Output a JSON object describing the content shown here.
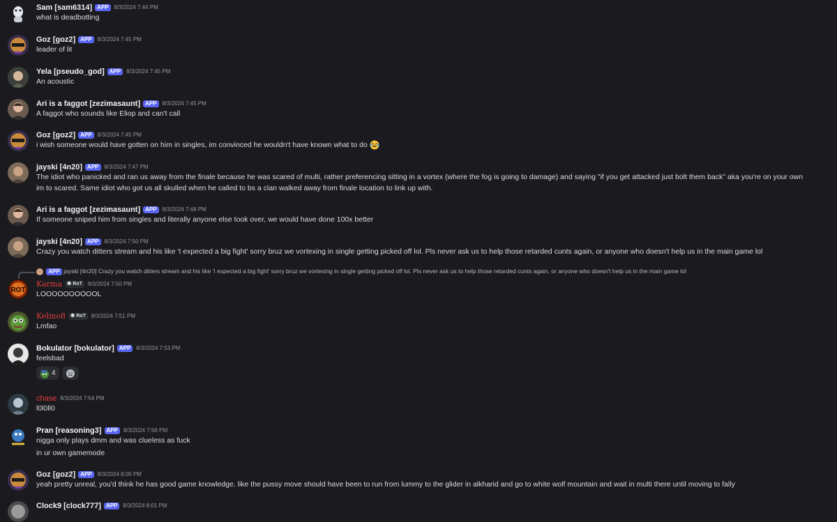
{
  "messages": [
    {
      "name": "Sam [sam6314]",
      "app": "APP",
      "time": "8/3/2024 7:44 PM",
      "lines": [
        "what is deadbotting"
      ]
    },
    {
      "name": "Goz [goz2]",
      "app": "APP",
      "time": "8/3/2024 7:45 PM",
      "lines": [
        "leader of lit"
      ]
    },
    {
      "name": "Yela [pseudo_god]",
      "app": "APP",
      "time": "8/3/2024 7:45 PM",
      "lines": [
        "An acoustic"
      ]
    },
    {
      "name": "Ari is a faggot [zezimasaunt]",
      "app": "APP",
      "time": "8/3/2024 7:45 PM",
      "lines": [
        "A faggot who sounds like Eliop and can't call"
      ]
    },
    {
      "name": "Goz [goz2]",
      "app": "APP",
      "time": "8/3/2024 7:45 PM",
      "lines": [
        "i wish someone would have gotten on him in singles, im convinced he wouldn't have known what to do"
      ]
    },
    {
      "name": "jayski [4n20]",
      "app": "APP",
      "time": "8/3/2024 7:47 PM",
      "lines": [
        "The idiot who panicked and ran us away from the finale because he was scared of multi, rather preferencing sitting in a vortex (where the fog is going to damage) and saying \"if you get attacked just bolt them back\" aka you're on your own",
        "im to scared. Same idiot who got us all skulled when he called to bs a clan walked away from finale location to link up with."
      ]
    },
    {
      "name": "Ari is a faggot [zezimasaunt]",
      "app": "APP",
      "time": "8/3/2024 7:48 PM",
      "lines": [
        "If someone sniped him from singles and literally anyone else took over, we would have done 100x better"
      ]
    },
    {
      "name": "jayski [4n20]",
      "app": "APP",
      "time": "8/3/2024 7:50 PM",
      "lines": [
        "Crazy you watch ditters stream and his like 'I expected a big fight'  sorry bruz we vortexing in single getting picked off lol.  Pls never ask us to help those retarded cunts again, or anyone who doesn't help us in the main game lol"
      ]
    },
    {
      "reply": {
        "app": "APP",
        "text": "jayski [4n20]  Crazy you watch ditters stream and his like 'I expected a big fight'  sorry bruz we vortexing in single getting picked off lol.  Pls never ask us to help those retarded cunts again, or anyone who doesn't help us in the main game lol"
      },
      "name": "Karma",
      "tag": "RoT",
      "time": "8/3/2024 7:50 PM",
      "lines": [
        "LOOOOOOOOOOL"
      ]
    },
    {
      "name": "Kelmo8",
      "tag": "RoT",
      "time": "8/3/2024 7:51 PM",
      "lines": [
        "Lmfao"
      ]
    },
    {
      "name": "Bokulator [bokulator]",
      "app": "APP",
      "time": "8/3/2024 7:53 PM",
      "lines": [
        "feelsbad"
      ],
      "reactions": [
        {
          "emoji": "pepe",
          "count": "4"
        },
        {
          "emoji": "sad-face",
          "count": ""
        }
      ]
    },
    {
      "name": "chase",
      "time": "8/3/2024 7:54 PM",
      "lines": [
        "l0l0ll0"
      ]
    },
    {
      "name": "Pran [reasoning3]",
      "app": "APP",
      "time": "8/3/2024 7:56 PM",
      "lines": [
        "nigga only plays dmm and was clueless as fuck",
        "in ur own gamemode"
      ]
    },
    {
      "name": "Goz [goz2]",
      "app": "APP",
      "time": "8/3/2024 8:00 PM",
      "lines": [
        "yeah pretty unreal, you'd think he has good game knowledge. like the pussy move should have been to run from lummy to the glider in alkharid and go to white wolf mountain and wait in multi there until moving to fally"
      ]
    },
    {
      "name": "Clock9 [clock777]",
      "app": "APP",
      "time": "8/3/2024 8:01 PM",
      "lines": []
    }
  ],
  "colors": {
    "background": "#1b1b1f",
    "app_badge": "#5865f2",
    "red_name": "#e23c3c",
    "timestamp": "#949ba4"
  }
}
